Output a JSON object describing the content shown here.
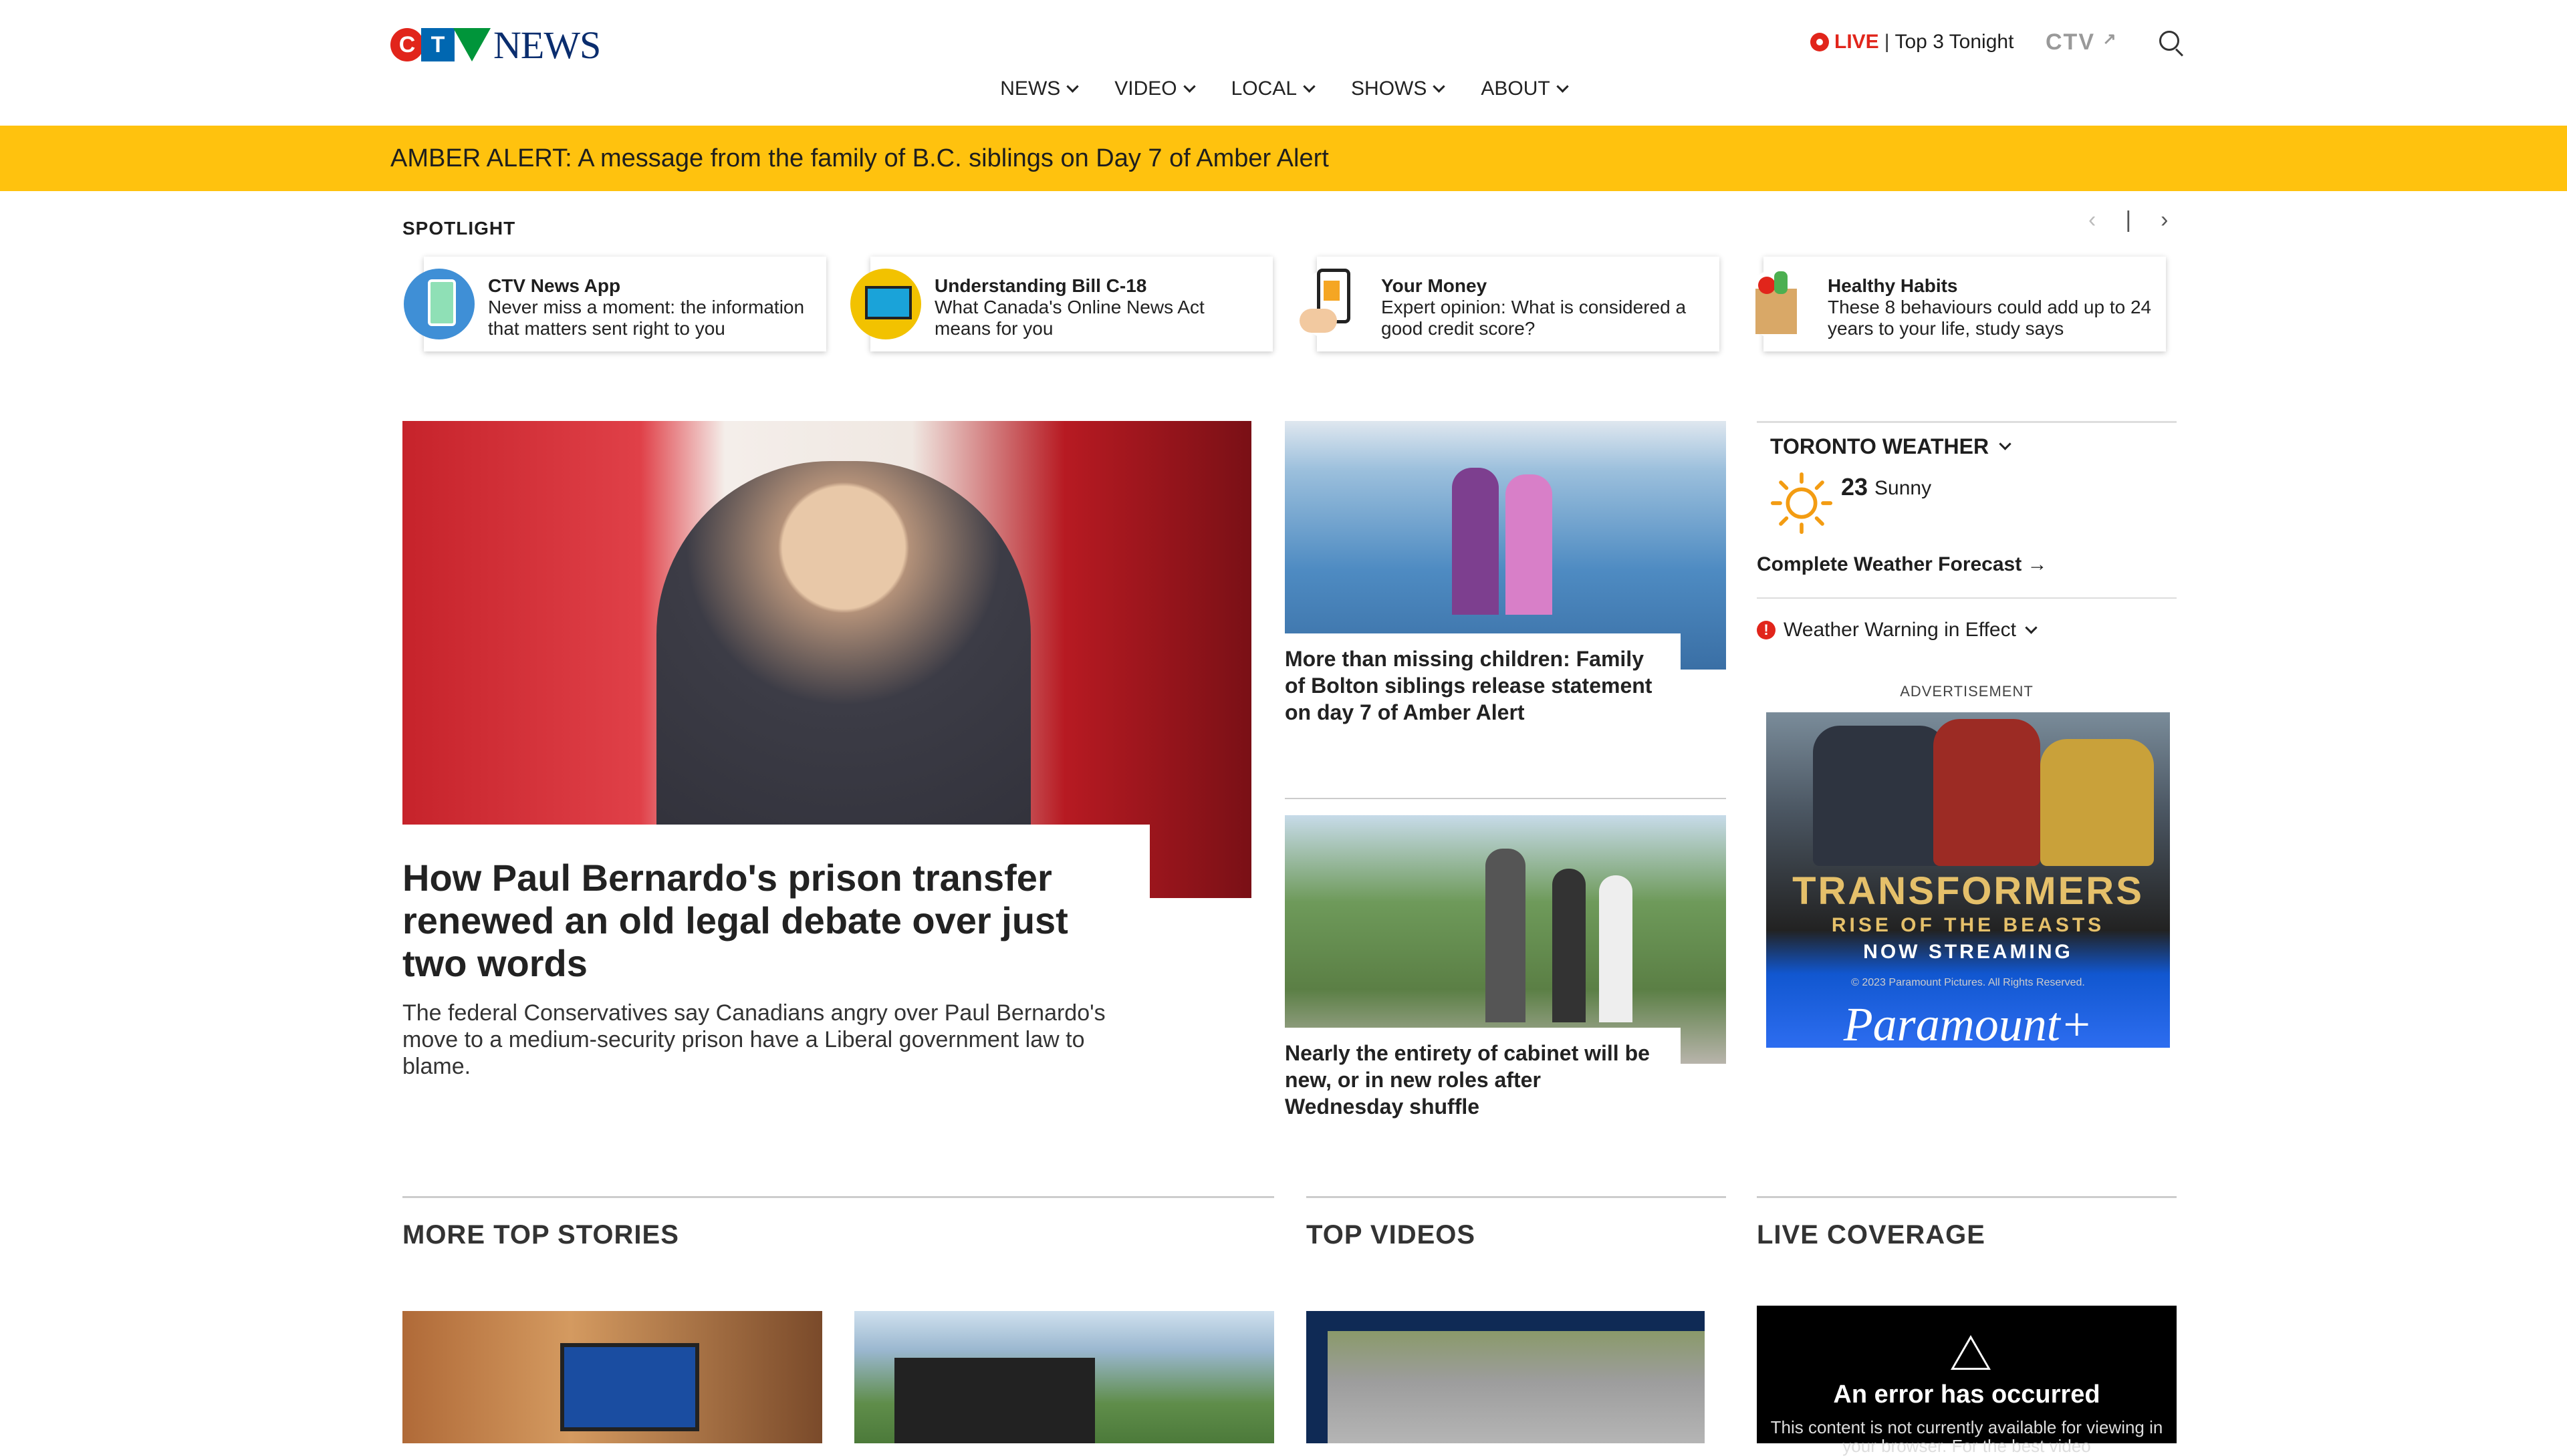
{
  "header": {
    "logo_text": "NEWS",
    "logo_letters": [
      "C",
      "T"
    ],
    "nav": [
      "NEWS",
      "VIDEO",
      "LOCAL",
      "SHOWS",
      "ABOUT"
    ],
    "live_label": "LIVE",
    "live_sep": "|",
    "live_text": "Top 3 Tonight",
    "ctv_link": "CTV"
  },
  "banner": {
    "text": "AMBER ALERT: A message from the family of B.C. siblings on Day 7 of Amber Alert"
  },
  "spotlight": {
    "label": "SPOTLIGHT",
    "prev": "‹",
    "sep": "|",
    "next": "›",
    "cards": [
      {
        "title": "CTV News App",
        "desc": "Never miss a moment: the information that matters sent right to you",
        "icon": "phone-app-icon",
        "color": "#3f8fd6"
      },
      {
        "title": "Understanding Bill C-18",
        "desc": "What Canada's Online News Act means for you",
        "icon": "monitor-icon",
        "color": "#f2c200"
      },
      {
        "title": "Your Money",
        "desc": "Expert opinion: What is considered a good credit score?",
        "icon": "phone-hand-icon",
        "color": "#ffffff"
      },
      {
        "title": "Healthy Habits",
        "desc": "These 8 behaviours could add up to 24 years to your life, study says",
        "icon": "grocery-bag-icon",
        "color": "#ffffff"
      }
    ]
  },
  "main_story": {
    "title": "How Paul Bernardo's prison transfer renewed an old legal debate over just two words",
    "desc": "The federal Conservatives say Canadians angry over Paul Bernardo's move to a medium-security prison have a Liberal government law to blame."
  },
  "side_stories": [
    {
      "title": "More than missing children: Family of Bolton siblings release statement on day 7 of Amber Alert"
    },
    {
      "title": "Nearly the entirety of cabinet will be new, or in new roles after Wednesday shuffle"
    }
  ],
  "weather": {
    "title": "TORONTO WEATHER",
    "temp": "23",
    "condition": "Sunny",
    "forecast_link": "Complete Weather Forecast →",
    "warning": "Weather Warning in Effect",
    "warning_mark": "!"
  },
  "ad": {
    "label": "ADVERTISEMENT",
    "line1": "TRANSFORMERS",
    "line2": "RISE OF THE BEASTS",
    "line3": "NOW STREAMING",
    "fine_print": "© 2023 Paramount Pictures. All Rights Reserved.",
    "brand": "Paramount+"
  },
  "sections": {
    "more_top": "MORE TOP STORIES",
    "top_videos": "TOP VIDEOS",
    "live_coverage": "LIVE COVERAGE"
  },
  "live_error": {
    "title": "An error has occurred",
    "text": "This content is not currently available for viewing in your browser. For the best video"
  }
}
